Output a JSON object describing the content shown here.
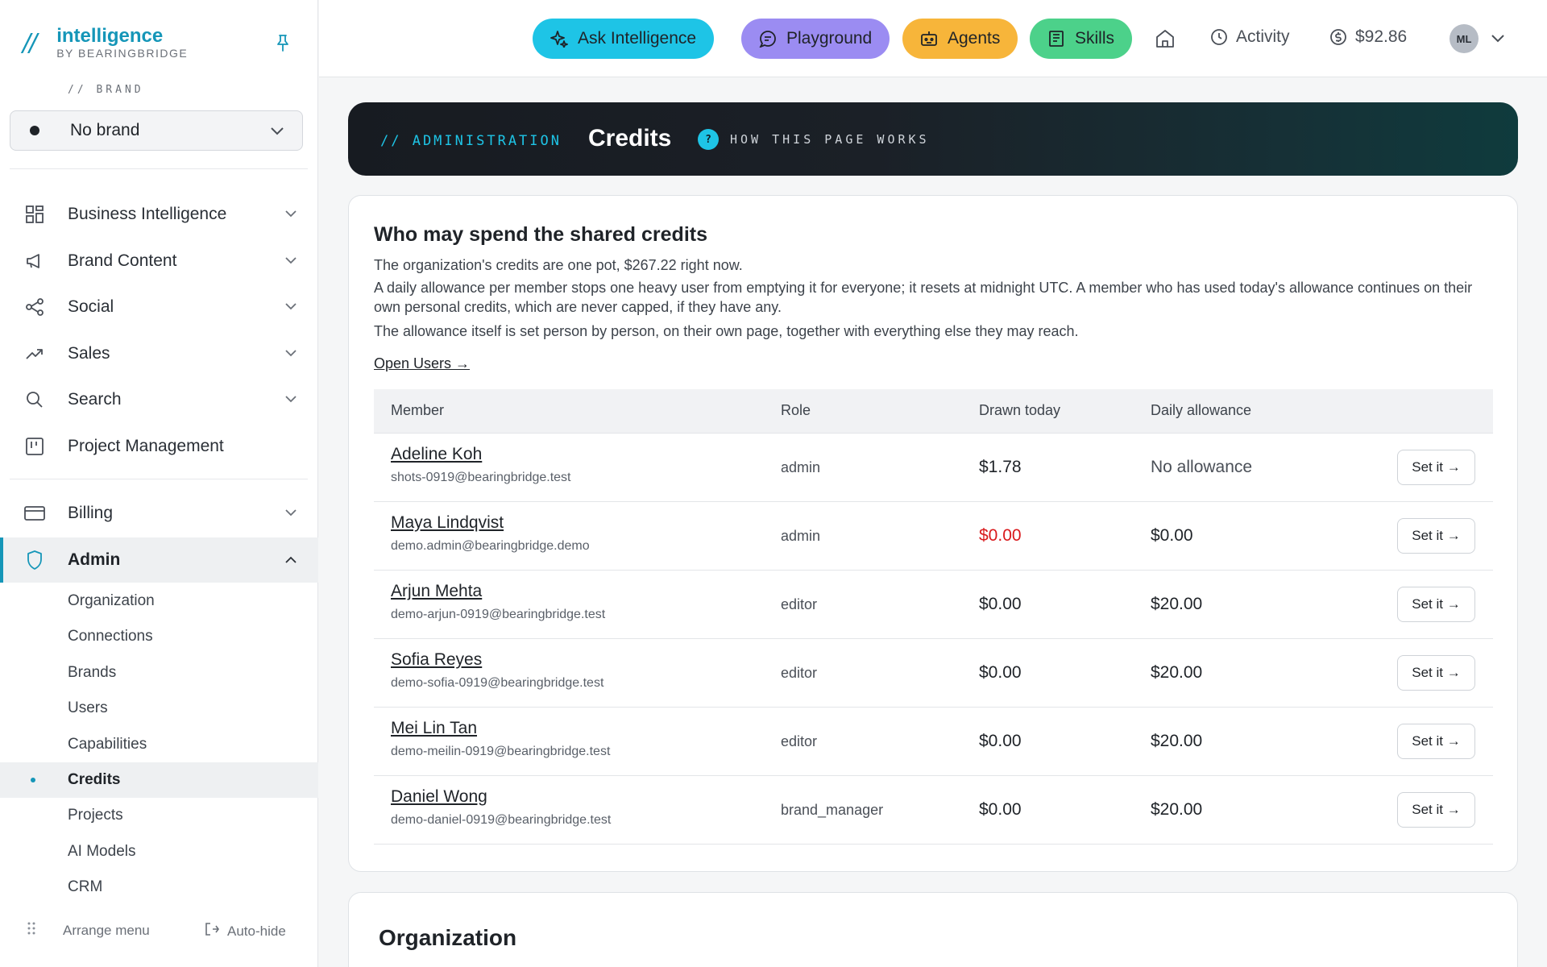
{
  "sidebar": {
    "logo": {
      "name": "intelligence",
      "byline": "BY BEARINGBRIDGE"
    },
    "brand_label": "// BRAND",
    "brand_select": "No brand",
    "nav": [
      {
        "label": "Business Intelligence",
        "icon": "grid-icon"
      },
      {
        "label": "Brand Content",
        "icon": "megaphone-icon"
      },
      {
        "label": "Social",
        "icon": "share-icon"
      },
      {
        "label": "Sales",
        "icon": "trending-up-icon"
      },
      {
        "label": "Search",
        "icon": "search-icon"
      },
      {
        "label": "Project Management",
        "icon": "kanban-icon"
      }
    ],
    "billing": "Billing",
    "admin": "Admin",
    "admin_items": [
      "Organization",
      "Connections",
      "Brands",
      "Users",
      "Capabilities",
      "Credits",
      "Projects",
      "AI Models",
      "CRM"
    ],
    "footer": {
      "arrange": "Arrange menu",
      "autohide": "Auto-hide"
    }
  },
  "topbar": {
    "ask": "Ask Intelligence",
    "playground": "Playground",
    "agents": "Agents",
    "skills": "Skills",
    "activity": "Activity",
    "balance": "$92.86",
    "avatar": "ML",
    "colors": {
      "ask": "#1ec4e6",
      "playground": "#9b8cf2",
      "agents": "#f7b53a",
      "skills": "#4cd18a"
    }
  },
  "banner": {
    "kicker": "// ADMINISTRATION",
    "title": "Credits",
    "help": "HOW THIS PAGE WORKS"
  },
  "card": {
    "title": "Who may spend the shared credits",
    "p1": "The organization's credits are one pot, $267.22 right now.",
    "p2": "A daily allowance per member stops one heavy user from emptying it for everyone; it resets at midnight UTC. A member who has used today's allowance continues on their own personal credits, which are never capped, if they have any.",
    "p3": "The allowance itself is set person by person, on their own page, together with everything else they may reach.",
    "link": "Open Users →",
    "headers": {
      "member": "Member",
      "role": "Role",
      "drawn": "Drawn today",
      "allowance": "Daily allowance"
    },
    "set_label": "Set it →",
    "rows": [
      {
        "name": "Adeline Koh",
        "email": "shots-0919@bearingbridge.test",
        "role": "admin",
        "drawn": "$1.78",
        "allowance": "No allowance"
      },
      {
        "name": "Maya Lindqvist",
        "email": "demo.admin@bearingbridge.demo",
        "role": "admin",
        "drawn": "$0.00",
        "allowance": "$0.00"
      },
      {
        "name": "Arjun Mehta",
        "email": "demo-arjun-0919@bearingbridge.test",
        "role": "editor",
        "drawn": "$0.00",
        "allowance": "$20.00"
      },
      {
        "name": "Sofia Reyes",
        "email": "demo-sofia-0919@bearingbridge.test",
        "role": "editor",
        "drawn": "$0.00",
        "allowance": "$20.00"
      },
      {
        "name": "Mei Lin Tan",
        "email": "demo-meilin-0919@bearingbridge.test",
        "role": "editor",
        "drawn": "$0.00",
        "allowance": "$20.00"
      },
      {
        "name": "Daniel Wong",
        "email": "demo-daniel-0919@bearingbridge.test",
        "role": "brand_manager",
        "drawn": "$0.00",
        "allowance": "$20.00"
      }
    ]
  },
  "card2": {
    "title": "Organization"
  }
}
